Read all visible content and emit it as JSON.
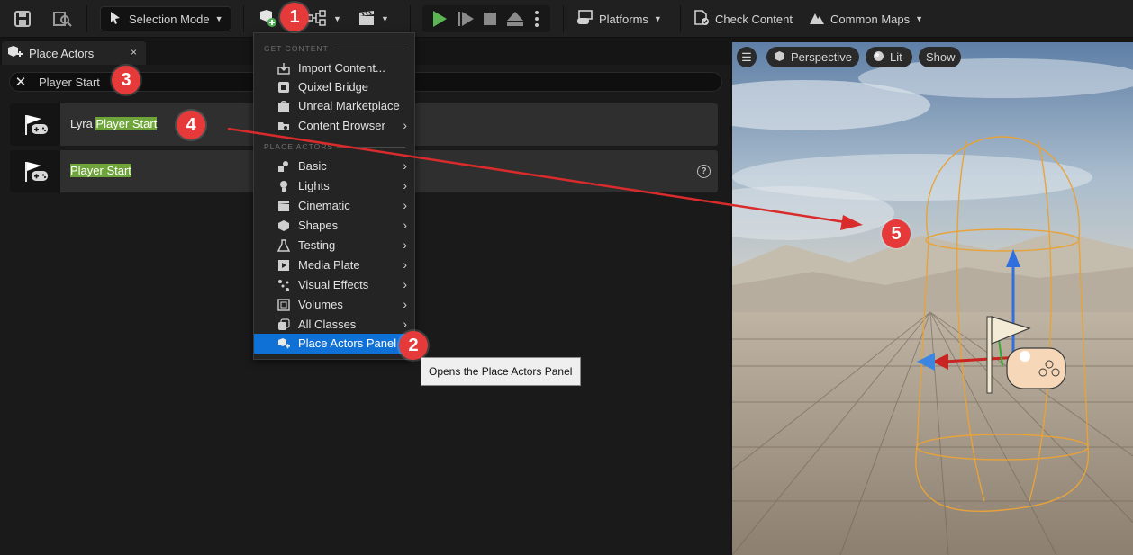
{
  "toolbar": {
    "mode_label": "Selection Mode",
    "platforms_label": "Platforms",
    "check_content_label": "Check Content",
    "common_maps_label": "Common Maps"
  },
  "tab": {
    "label": "Place Actors",
    "close": "×"
  },
  "search": {
    "value": "Player Start"
  },
  "results": [
    {
      "prefix": "Lyra ",
      "match": "Player Start"
    },
    {
      "prefix": "",
      "match": "Player Start"
    }
  ],
  "help_glyph": "?",
  "dropdown": {
    "section_get": "GET CONTENT",
    "get_items": [
      {
        "label": "Import Content...",
        "icon": "import-icon",
        "submenu": false
      },
      {
        "label": "Quixel Bridge",
        "icon": "bridge-icon",
        "submenu": false
      },
      {
        "label": "Unreal Marketplace",
        "icon": "marketplace-icon",
        "submenu": false
      },
      {
        "label": "Content Browser",
        "icon": "content-browser-icon",
        "submenu": true
      }
    ],
    "section_place": "PLACE ACTORS",
    "place_items": [
      {
        "label": "Basic",
        "icon": "basic-icon"
      },
      {
        "label": "Lights",
        "icon": "light-icon"
      },
      {
        "label": "Cinematic",
        "icon": "cinematic-icon"
      },
      {
        "label": "Shapes",
        "icon": "shapes-icon"
      },
      {
        "label": "Testing",
        "icon": "flask-icon"
      },
      {
        "label": "Media Plate",
        "icon": "media-plate-icon"
      },
      {
        "label": "Visual Effects",
        "icon": "vfx-icon"
      },
      {
        "label": "Volumes",
        "icon": "volume-icon"
      },
      {
        "label": "All Classes",
        "icon": "all-classes-icon"
      }
    ],
    "selected_item": "Place Actors Panel"
  },
  "tooltip": "Opens the Place Actors Panel",
  "viewport": {
    "perspective_label": "Perspective",
    "lit_label": "Lit",
    "show_label": "Show"
  },
  "badges": [
    "1",
    "2",
    "3",
    "4",
    "5"
  ],
  "colors": {
    "accent_blue": "#0f70d6",
    "highlight_green": "#6fa43a",
    "badge_red": "#e63a3a",
    "arrow_red": "#d92b2b",
    "selection_orange": "#e7a33a"
  }
}
